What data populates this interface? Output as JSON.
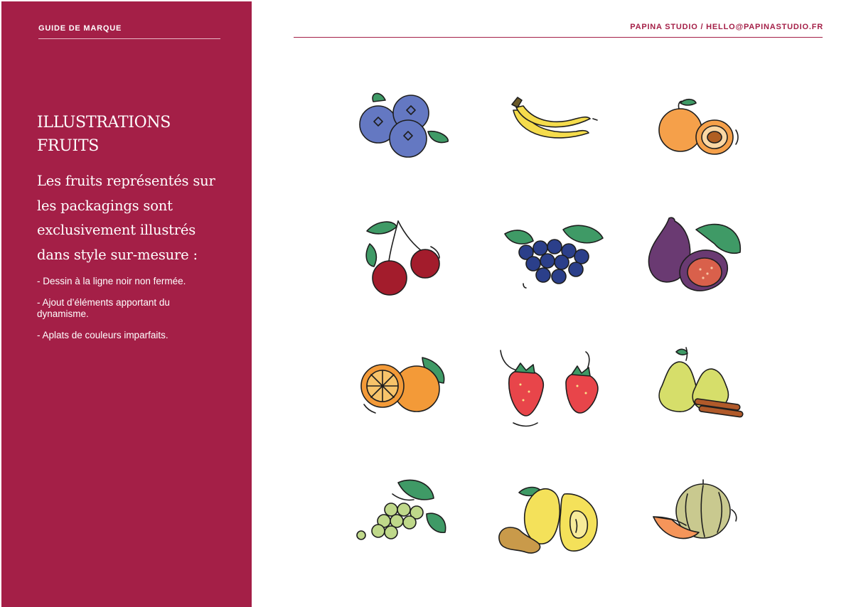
{
  "header": {
    "left": "GUIDE DE MARQUE",
    "right": "PAPINA STUDIO / HELLO@PAPINASTUDIO.FR"
  },
  "sidebar": {
    "title_lines": [
      "ILLUSTRATIONS",
      "FRUITS"
    ],
    "lead": "Les fruits représentés sur les packagings sont exclusivement illustrés dans style sur-mesure :",
    "bullets": [
      "- Dessin à la ligne noir non fermée.",
      "- Ajout d’éléments apportant du dynamisme.",
      "- Aplats de couleurs imparfaits."
    ]
  },
  "colors": {
    "brand": "#a41f47",
    "blueberry": "#6478c2",
    "banana": "#f5dc4c",
    "apricot": "#f5a04a",
    "cherry": "#a31c2c",
    "blackcurrant": "#2b3f8a",
    "fig": "#6a3a72",
    "orange": "#f39a38",
    "strawberry": "#e8454a",
    "pear": "#d6de6a",
    "grape": "#bfd88a",
    "quince": "#f4e15a",
    "melon": "#c9c98f",
    "leaf": "#3f9a66"
  },
  "fruits": [
    {
      "icon": "blueberries-icon"
    },
    {
      "icon": "bananas-icon"
    },
    {
      "icon": "apricot-icon"
    },
    {
      "icon": "cherries-icon"
    },
    {
      "icon": "blackcurrants-icon"
    },
    {
      "icon": "fig-icon"
    },
    {
      "icon": "orange-icon"
    },
    {
      "icon": "strawberries-icon"
    },
    {
      "icon": "pears-cinnamon-icon"
    },
    {
      "icon": "grapes-icon"
    },
    {
      "icon": "quince-ginger-icon"
    },
    {
      "icon": "melon-icon"
    }
  ]
}
